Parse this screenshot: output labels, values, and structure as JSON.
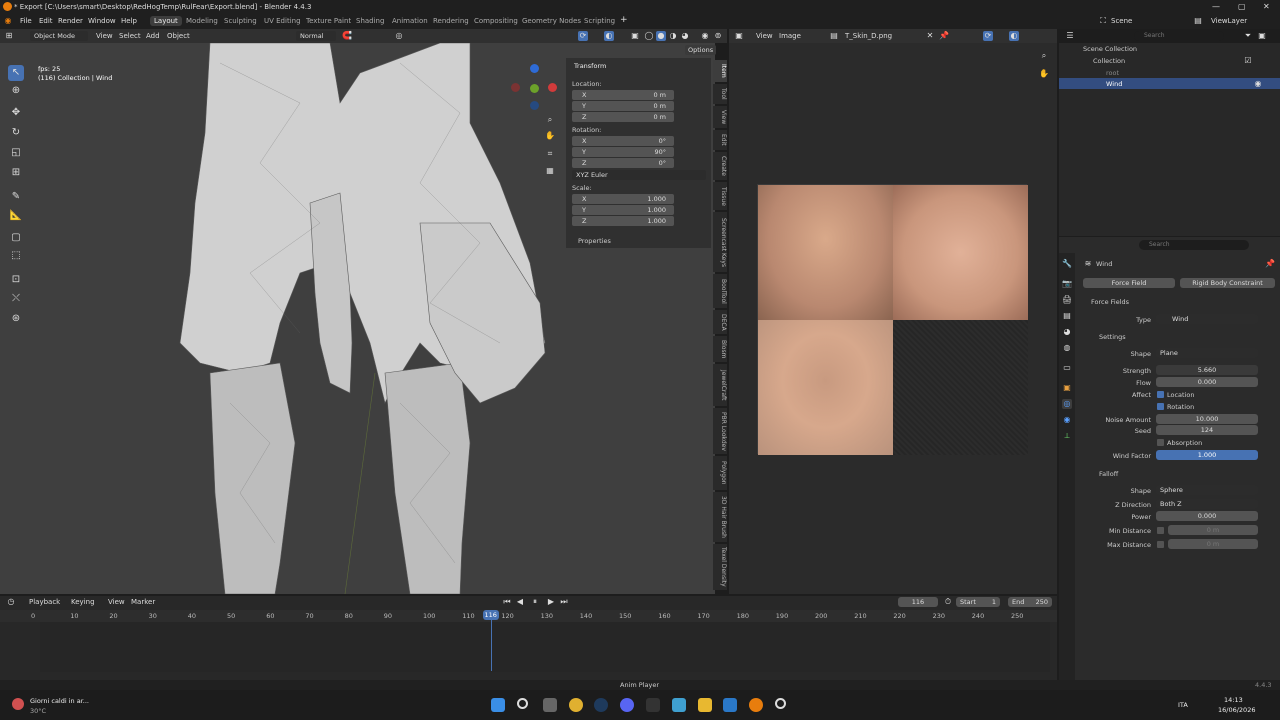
{
  "window": {
    "title": "* Export [C:\\Users\\smart\\Desktop\\RedHogTemp\\RulFear\\Export.blend] - Blender 4.4.3"
  },
  "menu": [
    "File",
    "Edit",
    "Render",
    "Window",
    "Help"
  ],
  "workspaces": [
    "Layout",
    "Modeling",
    "Sculpting",
    "UV Editing",
    "Texture Paint",
    "Shading",
    "Animation",
    "Rendering",
    "Compositing",
    "Geometry Nodes",
    "Scripting"
  ],
  "scene": {
    "label": "Scene",
    "view_layer": "ViewLayer"
  },
  "viewport_header": {
    "mode": "Object Mode",
    "view": "View",
    "select": "Select",
    "add": "Add",
    "object": "Object",
    "orientation": "Normal",
    "options": "Options"
  },
  "overlay": {
    "fps": "fps: 25",
    "collection": "(116) Collection | Wind"
  },
  "transform": {
    "title": "Transform",
    "location_label": "Location:",
    "rotation_label": "Rotation:",
    "scale_label": "Scale:",
    "location": [
      {
        "k": "X",
        "v": "0 m"
      },
      {
        "k": "Y",
        "v": "0 m"
      },
      {
        "k": "Z",
        "v": "0 m"
      }
    ],
    "rotation": [
      {
        "k": "X",
        "v": "0°"
      },
      {
        "k": "Y",
        "v": "90°"
      },
      {
        "k": "Z",
        "v": "0°"
      }
    ],
    "rotation_mode": "XYZ Euler",
    "scale": [
      {
        "k": "X",
        "v": "1.000"
      },
      {
        "k": "Y",
        "v": "1.000"
      },
      {
        "k": "Z",
        "v": "1.000"
      }
    ],
    "properties": "Properties"
  },
  "side_tabs": [
    "Item",
    "Tool",
    "View",
    "Edit",
    "Create",
    "Tissue",
    "Screencast Keys",
    "BoolTool",
    "DECA",
    "Blosm",
    "JewelCraft",
    "PBR Lookdev",
    "Polygon",
    "3D Hair Brush",
    "Texel Density"
  ],
  "image_editor": {
    "view": "View",
    "image": "Image",
    "file": "T_Skin_D.png"
  },
  "outliner": {
    "search": "Search",
    "scene_collection": "Scene Collection",
    "collection": "Collection",
    "root": "root",
    "wind": "Wind"
  },
  "props": {
    "search": "Search",
    "object": "Wind",
    "force_field_tab": "Force Field",
    "rigid_body_tab": "Rigid Body Constraint",
    "force_fields": "Force Fields",
    "type_label": "Type",
    "type_value": "Wind",
    "settings": "Settings",
    "shape_label": "Shape",
    "shape_value": "Plane",
    "strength_label": "Strength",
    "strength_value": "5.660",
    "flow_label": "Flow",
    "flow_value": "0.000",
    "affect_label": "Affect",
    "location": "Location",
    "rotation": "Rotation",
    "noise_label": "Noise Amount",
    "noise_value": "10.000",
    "seed_label": "Seed",
    "seed_value": "124",
    "absorption": "Absorption",
    "wind_factor_label": "Wind Factor",
    "wind_factor_value": "1.000",
    "falloff": "Falloff",
    "f_shape_label": "Shape",
    "f_shape_value": "Sphere",
    "zdir_label": "Z Direction",
    "zdir_value": "Both Z",
    "power_label": "Power",
    "power_value": "0.000",
    "min_label": "Min Distance",
    "min_value": "0 m",
    "max_label": "Max Distance",
    "max_value": "0 m"
  },
  "timeline": {
    "playback": "Playback",
    "keying": "Keying",
    "view": "View",
    "marker": "Marker",
    "current": "116",
    "start_label": "Start",
    "start": "1",
    "end_label": "End",
    "end": "250",
    "ticks": [
      "0",
      "10",
      "20",
      "30",
      "40",
      "50",
      "60",
      "70",
      "80",
      "90",
      "100",
      "110",
      "120",
      "130",
      "140",
      "150",
      "160",
      "170",
      "180",
      "190",
      "200",
      "210",
      "220",
      "230",
      "240",
      "250"
    ],
    "frame": "116",
    "frame_fraction": 0.464
  },
  "status": {
    "anim_player": "Anim Player",
    "version": "4.4.3"
  },
  "taskbar": {
    "weather": "Giorni caldi in ar...",
    "temp": "30°C",
    "lang": "ITA",
    "time": "14:13",
    "date": "16/06/2026"
  },
  "colors": {
    "accent": "#4772b3",
    "viewport": "#3f3f3f",
    "panel": "#303030"
  }
}
